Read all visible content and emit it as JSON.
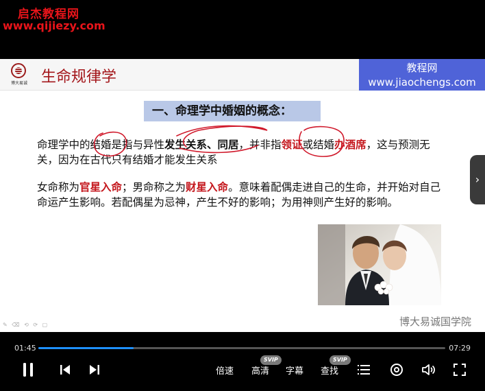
{
  "watermark": {
    "title": "启杰教程网",
    "url": "www.qijiezy.com",
    "box_name": "教程网",
    "box_url": "www.jiaochengs.com"
  },
  "slide": {
    "logo_text": "博大易诚",
    "title": "生命规律学",
    "heading": "一、命理学中婚姻的概念：",
    "para1": {
      "t1": "命理学中的结婚是指与异性",
      "b1": "发生关系、同居",
      "t2": "，并非指",
      "r1": "领证",
      "t3": "或结婚",
      "r2": "办酒席",
      "t4": "，这与预测无关，因为在古代只有结婚才能发生关系"
    },
    "para2": {
      "t1": "女命称为",
      "r1": "官星入命",
      "t2": "；男命称之为",
      "r2": "财星入命",
      "t3": "。意味着配偶走进自己的生命，并开始对自己命运产生影响。若配偶星为忌神，产生不好的影响；为用神则产生好的影响。"
    },
    "footer_org": "博大易诚国学院",
    "annotation_color": "#d0182a"
  },
  "player": {
    "current_time": "01:45",
    "total_time": "07:29",
    "progress": 0.234,
    "accent": "#1e90ff",
    "speed_label": "倍速",
    "quality_label": "高清",
    "subtitle_label": "字幕",
    "search_label": "查找",
    "badge_label": "SVIP",
    "icons": [
      "pause-icon",
      "prev-icon",
      "next-icon",
      "playlist-icon",
      "settings-icon",
      "volume-icon",
      "fullscreen-icon"
    ]
  }
}
